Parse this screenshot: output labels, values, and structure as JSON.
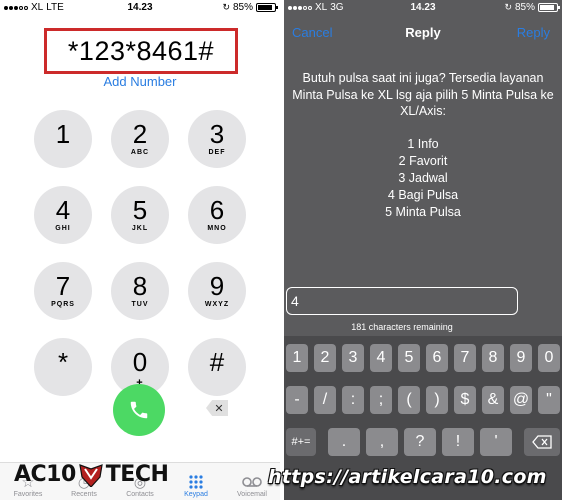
{
  "left_status": {
    "carrier": "XL",
    "network": "LTE",
    "time": "14.23",
    "battery": "85%"
  },
  "dialer": {
    "number": "*123*8461#",
    "add_number": "Add Number",
    "keys": [
      {
        "digit": "1",
        "letters": ""
      },
      {
        "digit": "2",
        "letters": "ABC"
      },
      {
        "digit": "3",
        "letters": "DEF"
      },
      {
        "digit": "4",
        "letters": "GHI"
      },
      {
        "digit": "5",
        "letters": "JKL"
      },
      {
        "digit": "6",
        "letters": "MNO"
      },
      {
        "digit": "7",
        "letters": "PQRS"
      },
      {
        "digit": "8",
        "letters": "TUV"
      },
      {
        "digit": "9",
        "letters": "WXYZ"
      },
      {
        "digit": "*",
        "letters": ""
      },
      {
        "digit": "0",
        "letters": "+"
      },
      {
        "digit": "#",
        "letters": ""
      }
    ]
  },
  "tabbar": {
    "tabs": [
      {
        "label": "Favorites",
        "icon": "star-icon"
      },
      {
        "label": "Recents",
        "icon": "clock-icon"
      },
      {
        "label": "Contacts",
        "icon": "person-icon"
      },
      {
        "label": "Keypad",
        "icon": "keypad-icon",
        "active": true
      },
      {
        "label": "Voicemail",
        "icon": "voicemail-icon"
      }
    ]
  },
  "logo": {
    "text_left": "AC10",
    "text_right": "TECH"
  },
  "right_status": {
    "carrier": "XL",
    "network": "3G",
    "time": "14.23",
    "battery": "85%"
  },
  "ussd": {
    "cancel": "Cancel",
    "title": "Reply",
    "reply": "Reply",
    "message": "Butuh pulsa saat ini juga? Tersedia layanan Minta Pulsa ke XL lsg aja pilih 5 Minta Pulsa ke XL/Axis:",
    "menu": [
      "1 Info",
      "2 Favorit",
      "3 Jadwal",
      "4 Bagi Pulsa",
      "5 Minta Pulsa"
    ],
    "input_value": "4",
    "remaining": "181 characters remaining"
  },
  "keyboard": {
    "row1": [
      "1",
      "2",
      "3",
      "4",
      "5",
      "6",
      "7",
      "8",
      "9",
      "0"
    ],
    "row2": [
      "-",
      "/",
      ":",
      ";",
      "(",
      ")",
      "$",
      "&",
      "@",
      "\""
    ],
    "row3_left": "#+=",
    "row3": [
      ".",
      ",",
      "?",
      "!",
      "'"
    ]
  },
  "watermark_url": "https://artikelcara10.com",
  "colors": {
    "accent_blue": "#2a7de1",
    "call_green": "#4cd964",
    "highlight_red": "#cc2a2a",
    "dialog_gray": "#5b5b5d"
  }
}
